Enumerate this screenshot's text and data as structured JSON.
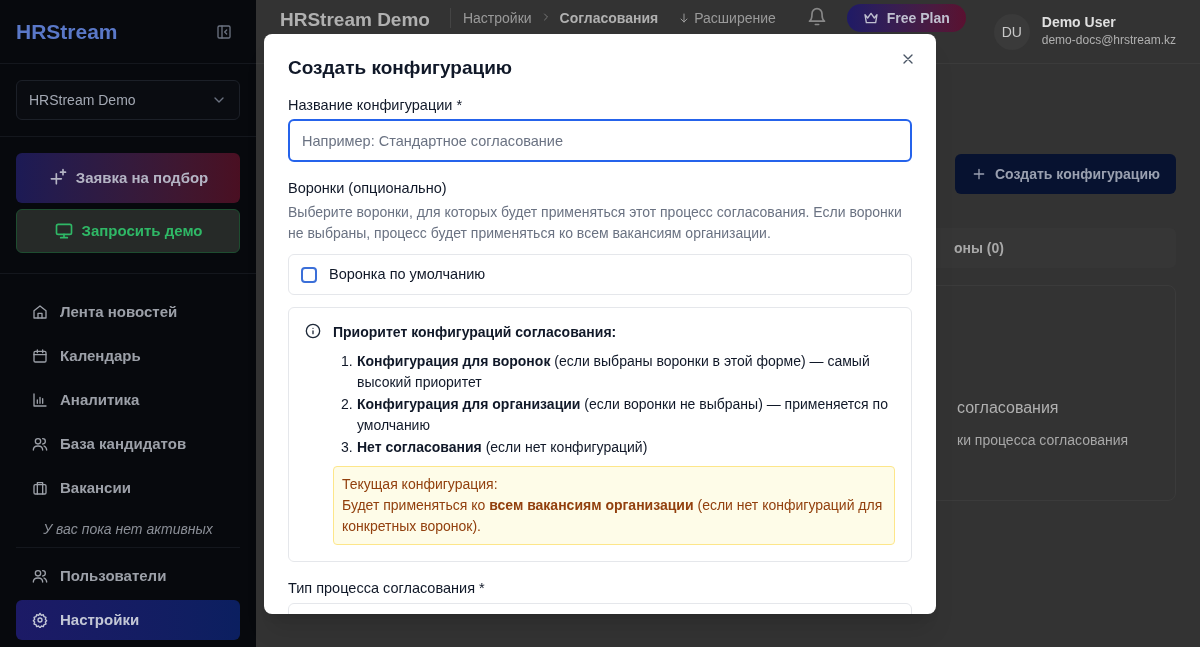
{
  "sidebar": {
    "logo": "HRStream",
    "organization": "HRStream Demo",
    "actions": [
      {
        "kind": "gradient",
        "label": "Заявка на подбор"
      },
      {
        "kind": "outline",
        "label": "Запросить демо"
      }
    ],
    "items": [
      {
        "label": "Лента новостей",
        "selected": false
      },
      {
        "label": "Календарь",
        "selected": false
      },
      {
        "label": "Аналитика",
        "selected": false
      },
      {
        "label": "База кандидатов",
        "selected": false
      },
      {
        "label": "Вакансии",
        "selected": false
      }
    ],
    "vacancies_note": "У вас пока нет активных",
    "bottom_items": [
      {
        "label": "Пользователи",
        "selected": false
      },
      {
        "label": "Настройки",
        "selected": true
      }
    ]
  },
  "header": {
    "title": "HRStream Demo",
    "breadcrumbs": [
      "Настройки",
      "Согласования"
    ],
    "extension": "Расширение",
    "plan": "Free Plan",
    "avatar": "DU",
    "user_name": "Demo User",
    "user_email": "demo-docs@hrstream.kz"
  },
  "page": {
    "create_button": "Создать конфигурацию",
    "tab": "оны (0)",
    "empty_title": "согласования",
    "empty_text": "ки процесса согласования"
  },
  "modal": {
    "title": "Создать конфигурацию",
    "name_label": "Название конфигурации *",
    "name_placeholder": "Например: Стандартное согласование",
    "funnels_label": "Воронки (опционально)",
    "funnels_hint": "Выберите воронки, для которых будет применяться этот процесс согласования. Если воронки не выбраны, процесс будет применяться ко всем вакансиям организации.",
    "funnels": [
      {
        "label": "Воронка по умолчанию",
        "checked": false
      }
    ],
    "info": {
      "title": "Приоритет конфигураций согласования:",
      "items": [
        {
          "number": "1.",
          "text": "**Конфигурация для воронок** (если выбраны воронки в этой форме) — самый высокий приоритет"
        },
        {
          "number": "2.",
          "text": "**Конфигурация для организации** (если воронки не выбраны) — применяется по умолчанию"
        },
        {
          "number": "3.",
          "text": "**Нет согласования** (если нет конфигураций)"
        }
      ],
      "current_title": "Текущая конфигурация:",
      "current_text": "Будет применяться ко **всем вакансиям организации** (если нет конфигураций для конкретных воронок)."
    },
    "type_label": "Тип процесса согласования *"
  }
}
